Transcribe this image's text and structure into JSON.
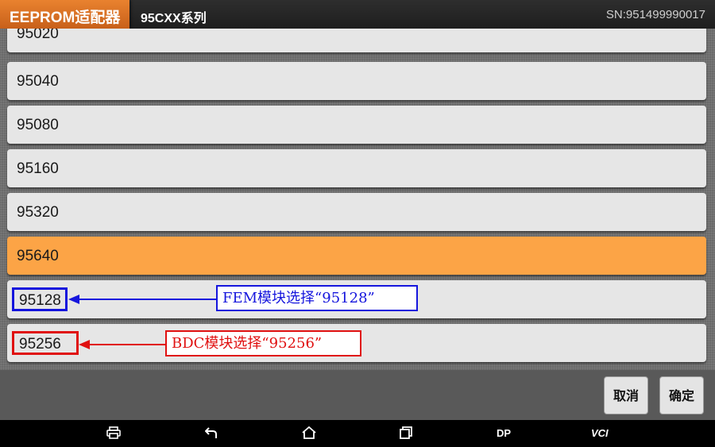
{
  "header": {
    "app_title": "EEPROM适配器",
    "series_title": "95CXX系列",
    "serial": "SN:951499990017"
  },
  "list": {
    "items": [
      {
        "label": "95020",
        "selected": false
      },
      {
        "label": "95040",
        "selected": false
      },
      {
        "label": "95080",
        "selected": false
      },
      {
        "label": "95160",
        "selected": false
      },
      {
        "label": "95320",
        "selected": false
      },
      {
        "label": "95640",
        "selected": true
      },
      {
        "label": "95128",
        "selected": false
      },
      {
        "label": "95256",
        "selected": false
      }
    ]
  },
  "annotations": {
    "fem": {
      "text": "FEM模块选择“95128”",
      "color": "#1515dd"
    },
    "bdc": {
      "text": "BDC模块选择“95256”",
      "color": "#e01010"
    }
  },
  "buttons": {
    "cancel": "取消",
    "confirm": "确定"
  },
  "navbar": {
    "dp_label": "DP",
    "vci_label": "VCI",
    "icons": [
      "printer-icon",
      "back-icon",
      "home-icon",
      "recent-apps-icon"
    ]
  },
  "colors": {
    "accent": "#e9822f",
    "selected_item": "#fca446",
    "list_item": "#e6e6e6"
  }
}
